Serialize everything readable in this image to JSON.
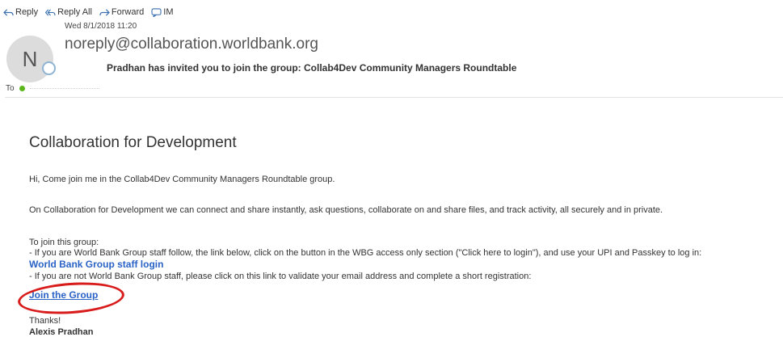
{
  "toolbar": {
    "reply": "Reply",
    "reply_all": "Reply All",
    "forward": "Forward",
    "im": "IM"
  },
  "message": {
    "date": "Wed 8/1/2018 11:20",
    "avatar_initial": "N",
    "sender": "noreply@collaboration.worldbank.org",
    "subject": "Pradhan has invited you to join the group: Collab4Dev Community Managers Roundtable",
    "to_label": "To"
  },
  "body": {
    "heading": "Collaboration for Development",
    "greeting": "Hi, Come join me in the Collab4Dev Community Managers Roundtable group.",
    "intro": "On Collaboration for Development we can connect and share instantly, ask questions, collaborate on and share files, and track activity, all securely and in private.",
    "join_intro": "To join this group:",
    "staff_instructions": "- If you are World Bank Group staff follow, the link below, click on the button in the WBG access only section (\"Click here to login\"), and use your UPI and Passkey to log in:",
    "staff_link": "World Bank Group staff login",
    "nonstaff_instructions": "- If you are not World Bank Group staff, please click on this link to validate your email address and complete a short registration:",
    "join_link": "Join the Group",
    "thanks": "Thanks!",
    "signature": "Alexis Pradhan"
  },
  "colors": {
    "link": "#2a62c6",
    "annotation": "#d81c1c",
    "presence_ring": "#8fb4d3"
  }
}
